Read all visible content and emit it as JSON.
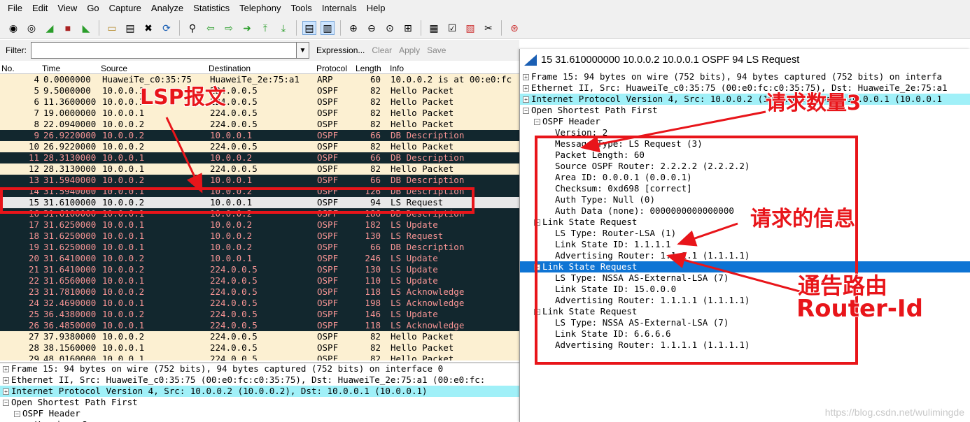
{
  "menu": [
    "File",
    "Edit",
    "View",
    "Go",
    "Capture",
    "Analyze",
    "Statistics",
    "Telephony",
    "Tools",
    "Internals",
    "Help"
  ],
  "filter": {
    "label": "Filter:",
    "value": "",
    "expression": "Expression...",
    "clear": "Clear",
    "apply": "Apply",
    "save": "Save"
  },
  "columns": [
    "No.",
    "Time",
    "Source",
    "Destination",
    "Protocol",
    "Length",
    "Info"
  ],
  "packets": [
    {
      "no": "4",
      "time": "0.0000000",
      "src": "HuaweiTe_c0:35:75",
      "dst": "HuaweiTe_2e:75:a1",
      "proto": "ARP",
      "len": "60",
      "info": "10.0.0.2 is at 00:e0:fc",
      "style": "arp"
    },
    {
      "no": "5",
      "time": "9.5000000",
      "src": "10.0.0.1",
      "dst": "224.0.0.5",
      "proto": "OSPF",
      "len": "82",
      "info": "Hello Packet",
      "style": "hello"
    },
    {
      "no": "6",
      "time": "11.3600000",
      "src": "10.0.0.1",
      "dst": "224.0.0.5",
      "proto": "OSPF",
      "len": "82",
      "info": "Hello Packet",
      "style": "hello"
    },
    {
      "no": "7",
      "time": "19.0000000",
      "src": "10.0.0.1",
      "dst": "224.0.0.5",
      "proto": "OSPF",
      "len": "82",
      "info": "Hello Packet",
      "style": "hello"
    },
    {
      "no": "8",
      "time": "22.0940000",
      "src": "10.0.0.2",
      "dst": "224.0.0.5",
      "proto": "OSPF",
      "len": "82",
      "info": "Hello Packet",
      "style": "hello"
    },
    {
      "no": "9",
      "time": "26.9220000",
      "src": "10.0.0.2",
      "dst": "10.0.0.1",
      "proto": "OSPF",
      "len": "66",
      "info": "DB Description",
      "style": "dark"
    },
    {
      "no": "10",
      "time": "26.9220000",
      "src": "10.0.0.2",
      "dst": "224.0.0.5",
      "proto": "OSPF",
      "len": "82",
      "info": "Hello Packet",
      "style": "hello"
    },
    {
      "no": "11",
      "time": "28.3130000",
      "src": "10.0.0.1",
      "dst": "10.0.0.2",
      "proto": "OSPF",
      "len": "66",
      "info": "DB Description",
      "style": "dark"
    },
    {
      "no": "12",
      "time": "28.3130000",
      "src": "10.0.0.1",
      "dst": "224.0.0.5",
      "proto": "OSPF",
      "len": "82",
      "info": "Hello Packet",
      "style": "hello"
    },
    {
      "no": "13",
      "time": "31.5940000",
      "src": "10.0.0.2",
      "dst": "10.0.0.1",
      "proto": "OSPF",
      "len": "66",
      "info": "DB Description",
      "style": "dark"
    },
    {
      "no": "14",
      "time": "31.5940000",
      "src": "10.0.0.1",
      "dst": "10.0.0.2",
      "proto": "OSPF",
      "len": "126",
      "info": "DB Description",
      "style": "dark"
    },
    {
      "no": "15",
      "time": "31.6100000",
      "src": "10.0.0.2",
      "dst": "10.0.0.1",
      "proto": "OSPF",
      "len": "94",
      "info": "LS Request",
      "style": "sel"
    },
    {
      "no": "16",
      "time": "31.6100000",
      "src": "10.0.0.1",
      "dst": "10.0.0.2",
      "proto": "OSPF",
      "len": "186",
      "info": "DB Description",
      "style": "dark"
    },
    {
      "no": "17",
      "time": "31.6250000",
      "src": "10.0.0.1",
      "dst": "10.0.0.2",
      "proto": "OSPF",
      "len": "182",
      "info": "LS Update",
      "style": "dark"
    },
    {
      "no": "18",
      "time": "31.6250000",
      "src": "10.0.0.1",
      "dst": "10.0.0.2",
      "proto": "OSPF",
      "len": "130",
      "info": "LS Request",
      "style": "dark"
    },
    {
      "no": "19",
      "time": "31.6250000",
      "src": "10.0.0.1",
      "dst": "10.0.0.2",
      "proto": "OSPF",
      "len": "66",
      "info": "DB Description",
      "style": "dark"
    },
    {
      "no": "20",
      "time": "31.6410000",
      "src": "10.0.0.2",
      "dst": "10.0.0.1",
      "proto": "OSPF",
      "len": "246",
      "info": "LS Update",
      "style": "dark"
    },
    {
      "no": "21",
      "time": "31.6410000",
      "src": "10.0.0.2",
      "dst": "224.0.0.5",
      "proto": "OSPF",
      "len": "130",
      "info": "LS Update",
      "style": "dark"
    },
    {
      "no": "22",
      "time": "31.6560000",
      "src": "10.0.0.1",
      "dst": "224.0.0.5",
      "proto": "OSPF",
      "len": "110",
      "info": "LS Update",
      "style": "dark"
    },
    {
      "no": "23",
      "time": "31.7810000",
      "src": "10.0.0.2",
      "dst": "224.0.0.5",
      "proto": "OSPF",
      "len": "118",
      "info": "LS Acknowledge",
      "style": "dark"
    },
    {
      "no": "24",
      "time": "32.4690000",
      "src": "10.0.0.1",
      "dst": "224.0.0.5",
      "proto": "OSPF",
      "len": "198",
      "info": "LS Acknowledge",
      "style": "dark"
    },
    {
      "no": "25",
      "time": "36.4380000",
      "src": "10.0.0.2",
      "dst": "224.0.0.5",
      "proto": "OSPF",
      "len": "146",
      "info": "LS Update",
      "style": "dark"
    },
    {
      "no": "26",
      "time": "36.4850000",
      "src": "10.0.0.1",
      "dst": "224.0.0.5",
      "proto": "OSPF",
      "len": "118",
      "info": "LS Acknowledge",
      "style": "dark"
    },
    {
      "no": "27",
      "time": "37.9380000",
      "src": "10.0.0.2",
      "dst": "224.0.0.5",
      "proto": "OSPF",
      "len": "82",
      "info": "Hello Packet",
      "style": "hello"
    },
    {
      "no": "28",
      "time": "38.1560000",
      "src": "10.0.0.1",
      "dst": "224.0.0.5",
      "proto": "OSPF",
      "len": "82",
      "info": "Hello Packet",
      "style": "hello"
    },
    {
      "no": "29",
      "time": "48.0160000",
      "src": "10.0.0.1",
      "dst": "224.0.0.5",
      "proto": "OSPF",
      "len": "82",
      "info": "Hello Packet",
      "style": "hello"
    }
  ],
  "bottom_details": [
    {
      "text": "Frame 15: 94 bytes on wire (752 bits), 94 bytes captured (752 bits) on interface 0",
      "tog": "+",
      "indent": 0,
      "style": ""
    },
    {
      "text": "Ethernet II, Src: HuaweiTe_c0:35:75 (00:e0:fc:c0:35:75), Dst: HuaweiTe_2e:75:a1 (00:e0:fc:",
      "tog": "+",
      "indent": 0,
      "style": ""
    },
    {
      "text": "Internet Protocol Version 4, Src: 10.0.0.2 (10.0.0.2), Dst: 10.0.0.1 (10.0.0.1)",
      "tog": "+",
      "indent": 0,
      "style": "ip"
    },
    {
      "text": "Open Shortest Path First",
      "tog": "-",
      "indent": 0,
      "style": ""
    },
    {
      "text": "OSPF Header",
      "tog": "-",
      "indent": 1,
      "style": ""
    },
    {
      "text": "Version: 2",
      "tog": "",
      "indent": 2,
      "style": ""
    }
  ],
  "popup": {
    "title": "15 31.610000000 10.0.0.2 10.0.0.1 OSPF 94 LS Request",
    "lines": [
      {
        "text": "Frame 15: 94 bytes on wire (752 bits), 94 bytes captured (752 bits) on interfa",
        "tog": "+",
        "indent": 0,
        "style": ""
      },
      {
        "text": "Ethernet II, Src: HuaweiTe_c0:35:75 (00:e0:fc:c0:35:75), Dst: HuaweiTe_2e:75:a1",
        "tog": "+",
        "indent": 0,
        "style": ""
      },
      {
        "text": "Internet Protocol Version 4, Src: 10.0.0.2 (10.0.0.2), Dst: 10.0.0.1 (10.0.0.1",
        "tog": "+",
        "indent": 0,
        "style": "ip"
      },
      {
        "text": "Open Shortest Path First",
        "tog": "-",
        "indent": 0,
        "style": ""
      },
      {
        "text": "OSPF Header",
        "tog": "-",
        "indent": 1,
        "style": ""
      },
      {
        "text": "Version: 2",
        "tog": "",
        "indent": 2,
        "style": ""
      },
      {
        "text": "Message Type: LS Request (3)",
        "tog": "",
        "indent": 2,
        "style": ""
      },
      {
        "text": "Packet Length: 60",
        "tog": "",
        "indent": 2,
        "style": ""
      },
      {
        "text": "Source OSPF Router: 2.2.2.2 (2.2.2.2)",
        "tog": "",
        "indent": 2,
        "style": ""
      },
      {
        "text": "Area ID: 0.0.0.1 (0.0.0.1)",
        "tog": "",
        "indent": 2,
        "style": ""
      },
      {
        "text": "Checksum: 0xd698 [correct]",
        "tog": "",
        "indent": 2,
        "style": ""
      },
      {
        "text": "Auth Type: Null (0)",
        "tog": "",
        "indent": 2,
        "style": ""
      },
      {
        "text": "Auth Data (none): 0000000000000000",
        "tog": "",
        "indent": 2,
        "style": ""
      },
      {
        "text": "Link State Request",
        "tog": "-",
        "indent": 1,
        "style": ""
      },
      {
        "text": "LS Type: Router-LSA (1)",
        "tog": "",
        "indent": 2,
        "style": ""
      },
      {
        "text": "Link State ID: 1.1.1.1",
        "tog": "",
        "indent": 2,
        "style": ""
      },
      {
        "text": "Advertising Router: 1.1.1.1 (1.1.1.1)",
        "tog": "",
        "indent": 2,
        "style": ""
      },
      {
        "text": "Link State Request",
        "tog": "-",
        "indent": 1,
        "style": "hl"
      },
      {
        "text": "LS Type: NSSA AS-External-LSA (7)",
        "tog": "",
        "indent": 2,
        "style": ""
      },
      {
        "text": "Link State ID: 15.0.0.0",
        "tog": "",
        "indent": 2,
        "style": ""
      },
      {
        "text": "Advertising Router: 1.1.1.1 (1.1.1.1)",
        "tog": "",
        "indent": 2,
        "style": ""
      },
      {
        "text": "Link State Request",
        "tog": "-",
        "indent": 1,
        "style": ""
      },
      {
        "text": "LS Type: NSSA AS-External-LSA (7)",
        "tog": "",
        "indent": 2,
        "style": ""
      },
      {
        "text": "Link State ID: 6.6.6.6",
        "tog": "",
        "indent": 2,
        "style": ""
      },
      {
        "text": "Advertising Router: 1.1.1.1 (1.1.1.1)",
        "tog": "",
        "indent": 2,
        "style": ""
      }
    ]
  },
  "annotations": {
    "lsp": "LSP报文",
    "count": "请求数量3",
    "info": "请求的信息",
    "adv": "通告路由",
    "router_id": "Router-Id",
    "color": "#e8151a"
  },
  "watermark": "https://blog.csdn.net/wulimingde"
}
